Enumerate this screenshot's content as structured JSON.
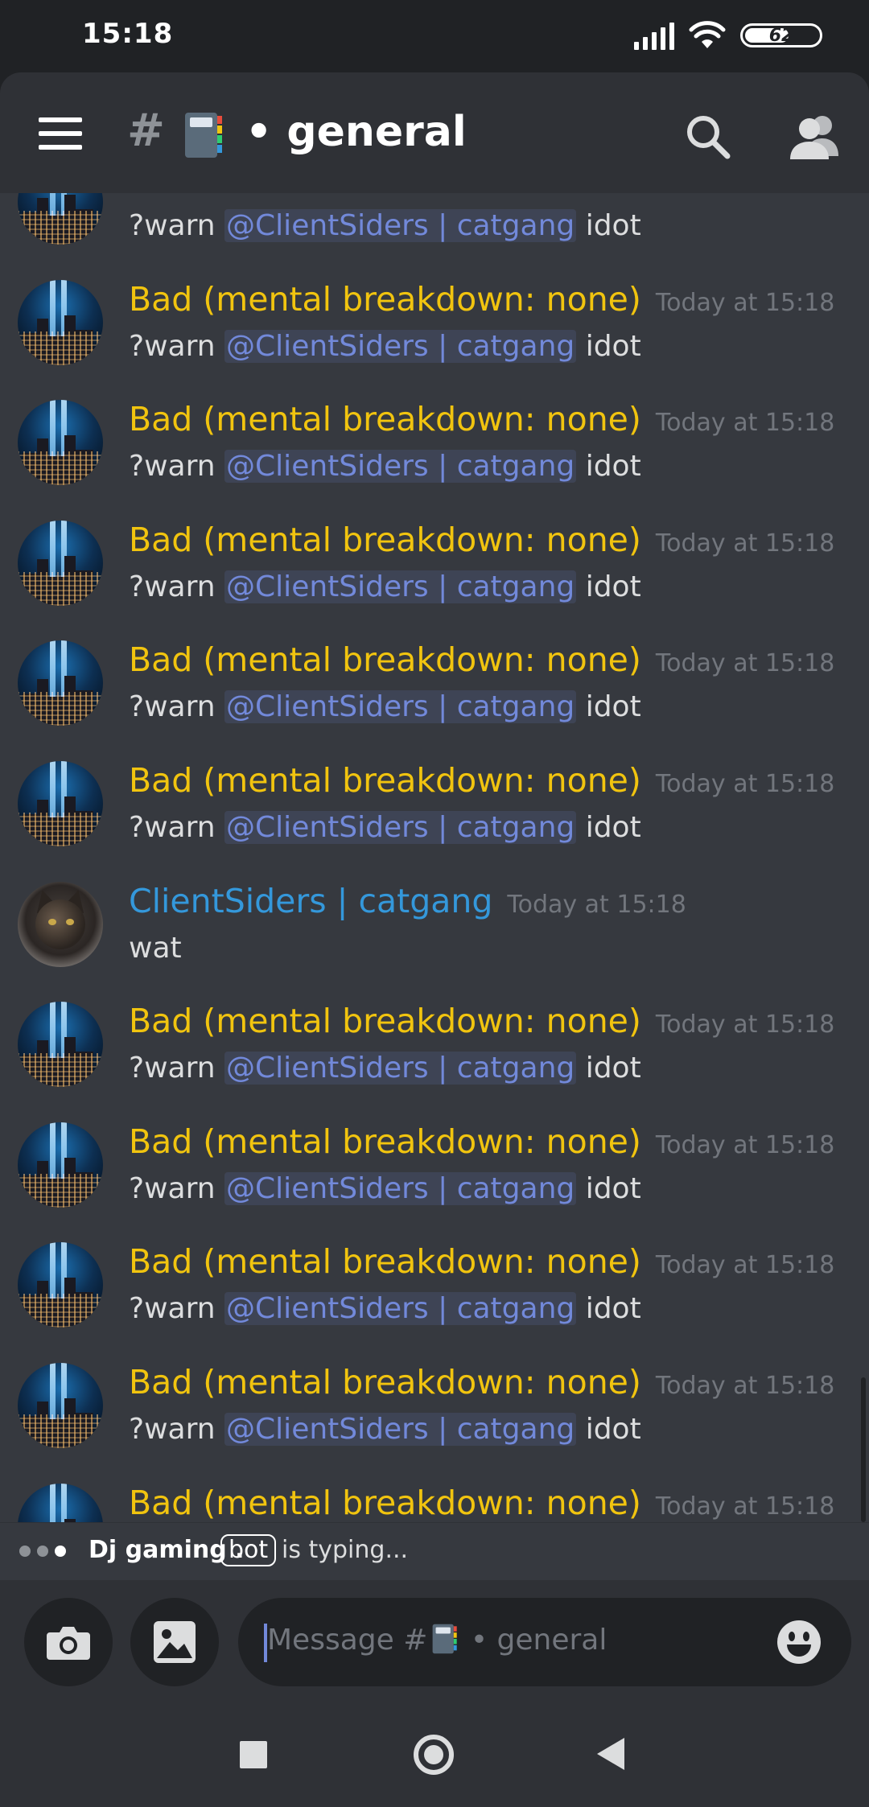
{
  "status_bar": {
    "time": "15:18",
    "battery": "62"
  },
  "header": {
    "hash": "#",
    "channel_name": "• general"
  },
  "messages": [
    {
      "author": "",
      "timestamp": "",
      "prefix": "?warn ",
      "mention": "@ClientSiders | catgang",
      "suffix": " idot",
      "avatar": "city"
    },
    {
      "author": "Bad (mental breakdown: none)",
      "timestamp": "Today at 15:18",
      "prefix": "?warn ",
      "mention": "@ClientSiders | catgang",
      "suffix": " idot",
      "avatar": "city"
    },
    {
      "author": "Bad (mental breakdown: none)",
      "timestamp": "Today at 15:18",
      "prefix": "?warn ",
      "mention": "@ClientSiders | catgang",
      "suffix": " idot",
      "avatar": "city"
    },
    {
      "author": "Bad (mental breakdown: none)",
      "timestamp": "Today at 15:18",
      "prefix": "?warn ",
      "mention": "@ClientSiders | catgang",
      "suffix": " idot",
      "avatar": "city"
    },
    {
      "author": "Bad (mental breakdown: none)",
      "timestamp": "Today at 15:18",
      "prefix": "?warn ",
      "mention": "@ClientSiders | catgang",
      "suffix": " idot",
      "avatar": "city"
    },
    {
      "author": "Bad (mental breakdown: none)",
      "timestamp": "Today at 15:18",
      "prefix": "?warn ",
      "mention": "@ClientSiders | catgang",
      "suffix": " idot",
      "avatar": "city"
    },
    {
      "author": "ClientSiders | catgang",
      "timestamp": "Today at 15:18",
      "prefix": "wat",
      "mention": "",
      "suffix": "",
      "avatar": "cat"
    },
    {
      "author": "Bad (mental breakdown: none)",
      "timestamp": "Today at 15:18",
      "prefix": "?warn ",
      "mention": "@ClientSiders | catgang",
      "suffix": " idot",
      "avatar": "city"
    },
    {
      "author": "Bad (mental breakdown: none)",
      "timestamp": "Today at 15:18",
      "prefix": "?warn ",
      "mention": "@ClientSiders | catgang",
      "suffix": " idot",
      "avatar": "city"
    },
    {
      "author": "Bad (mental breakdown: none)",
      "timestamp": "Today at 15:18",
      "prefix": "?warn ",
      "mention": "@ClientSiders | catgang",
      "suffix": " idot",
      "avatar": "city"
    },
    {
      "author": "Bad (mental breakdown: none)",
      "timestamp": "Today at 15:18",
      "prefix": "?warn ",
      "mention": "@ClientSiders | catgang",
      "suffix": " idot",
      "avatar": "city"
    },
    {
      "author": "Bad (mental breakdown: none)",
      "timestamp": "Today at 15:18",
      "prefix": "",
      "mention": "",
      "suffix": "",
      "avatar": "city"
    }
  ],
  "typing": {
    "user": "Dj gaming .",
    "tag": "bot",
    "text": "is typing..."
  },
  "composer": {
    "placeholder_prefix": "Message #",
    "placeholder_suffix": " • general"
  },
  "colors": {
    "bad_author": "#f1c40f",
    "cs_author": "#3498db",
    "mention": "#7289da",
    "background": "#36393f"
  },
  "icons": {
    "menu": "menu-icon",
    "search": "search-icon",
    "members": "members-icon",
    "camera": "camera-icon",
    "image": "image-icon",
    "emoji": "emoji-icon",
    "nav_recents": "recents-icon",
    "nav_home": "home-icon",
    "nav_back": "back-icon"
  }
}
